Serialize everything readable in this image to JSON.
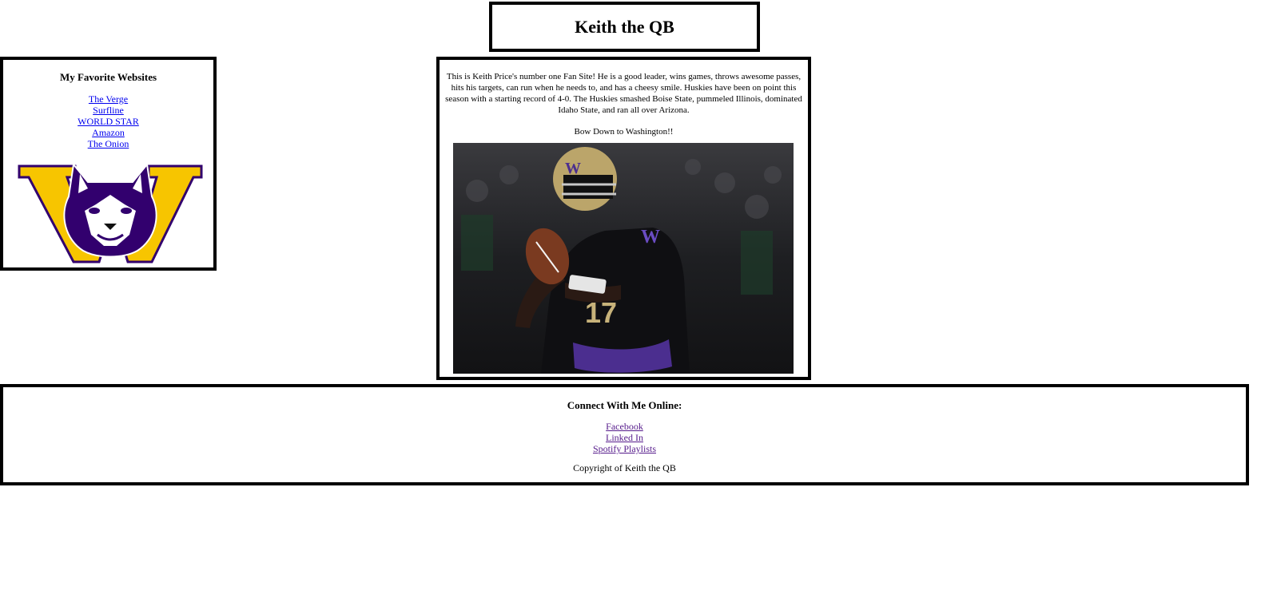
{
  "header": {
    "title": "Keith the QB"
  },
  "sidebar": {
    "heading": "My Favorite Websites",
    "links": [
      "The Verge",
      "Surfline",
      "WORLD STAR",
      "Amazon",
      "The Onion"
    ],
    "logo_icon": "uw-husky-logo",
    "colors": {
      "purple": "#32006e",
      "gold": "#f7c500"
    }
  },
  "main": {
    "intro": "This is Keith Price's number one Fan Site! He is a good leader, wins games, throws awesome passes, hits his targets, can run when he needs to, and has a cheesy smile. Huskies have been on point this season with a starting record of 4-0. The Huskies smashed Boise State, pummeled Illinois, dominated Idaho State, and ran all over Arizona.",
    "tagline": "Bow Down to Washington!!",
    "photo_icon": "quarterback-photo"
  },
  "footer": {
    "heading": "Connect With Me Online:",
    "links": [
      "Facebook",
      "Linked In",
      "Spotify Playlists"
    ],
    "copyright": "Copyright of Keith the QB"
  }
}
